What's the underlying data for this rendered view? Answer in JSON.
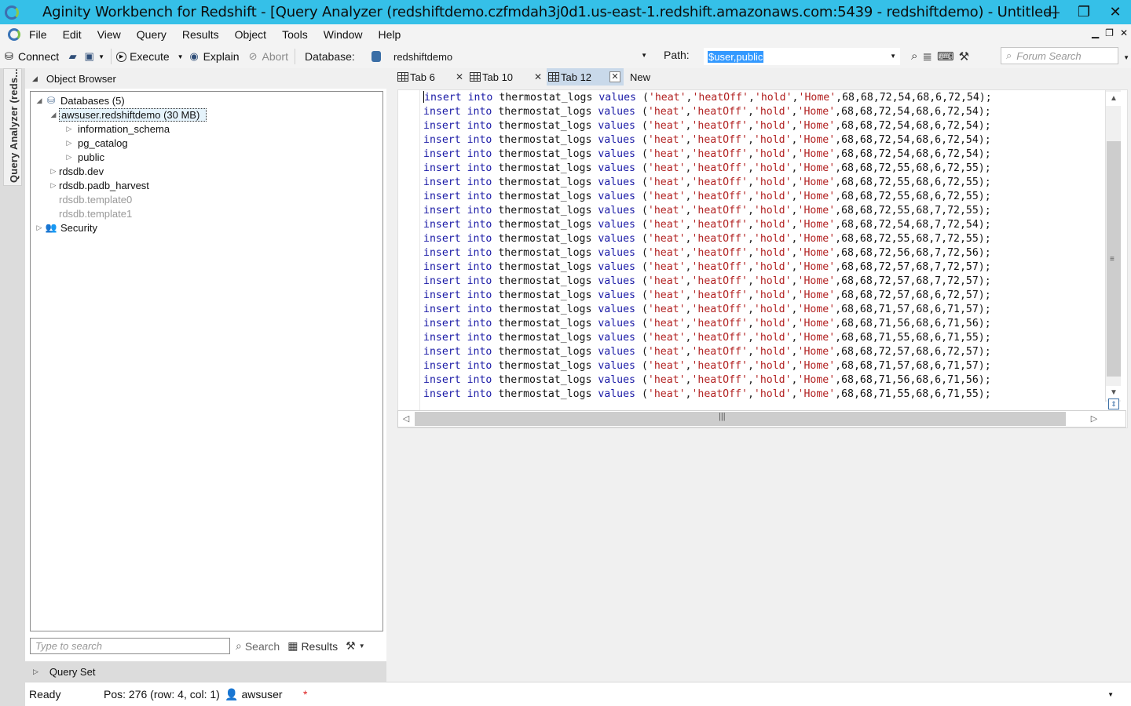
{
  "window": {
    "title": "Aginity Workbench for Redshift - [Query Analyzer (redshiftdemo.czfmdah3j0d1.us-east-1.redshift.amazonaws.com:5439 - redshiftdemo) - Untitled]",
    "minimize": "—",
    "restore": "❐",
    "close": "✕"
  },
  "menu": [
    "File",
    "Edit",
    "View",
    "Query",
    "Results",
    "Object",
    "Tools",
    "Window",
    "Help"
  ],
  "toolbar": {
    "connect": "Connect",
    "execute": "Execute",
    "explain": "Explain",
    "abort": "Abort",
    "database_label": "Database:",
    "database_value": "redshiftdemo",
    "path_label": "Path:",
    "path_value": "$user,public",
    "forum_search_placeholder": "Forum Search"
  },
  "side_tab": "Query Analyzer (reds...",
  "object_browser": {
    "title": "Object Browser",
    "tree": {
      "databases": "Databases (5)",
      "awsuser": "awsuser.redshiftdemo (30 MB)",
      "information_schema": "information_schema",
      "pg_catalog": "pg_catalog",
      "public": "public",
      "rdsdb_dev": "rdsdb.dev",
      "rdsdb_padb": "rdsdb.padb_harvest",
      "template0": "rdsdb.template0",
      "template1": "rdsdb.template1",
      "security": "Security"
    },
    "search_placeholder": "Type to search",
    "search_btn": "Search",
    "results_btn": "Results"
  },
  "query_set": "Query Set",
  "tabs": [
    {
      "label": "Tab 6"
    },
    {
      "label": "Tab 10"
    },
    {
      "label": "Tab 12"
    },
    {
      "label": "New"
    }
  ],
  "editor": {
    "keyword1": "insert",
    "keyword2": "into",
    "table": "thermostat_logs",
    "keyword3": "values",
    "lines": [
      [
        "'heat'",
        "'heatOff'",
        "'hold'",
        "'Home'",
        "68,68,72,54,68,6,72,54"
      ],
      [
        "'heat'",
        "'heatOff'",
        "'hold'",
        "'Home'",
        "68,68,72,54,68,6,72,54"
      ],
      [
        "'heat'",
        "'heatOff'",
        "'hold'",
        "'Home'",
        "68,68,72,54,68,6,72,54"
      ],
      [
        "'heat'",
        "'heatOff'",
        "'hold'",
        "'Home'",
        "68,68,72,54,68,6,72,54"
      ],
      [
        "'heat'",
        "'heatOff'",
        "'hold'",
        "'Home'",
        "68,68,72,54,68,6,72,54"
      ],
      [
        "'heat'",
        "'heatOff'",
        "'hold'",
        "'Home'",
        "68,68,72,55,68,6,72,55"
      ],
      [
        "'heat'",
        "'heatOff'",
        "'hold'",
        "'Home'",
        "68,68,72,55,68,6,72,55"
      ],
      [
        "'heat'",
        "'heatOff'",
        "'hold'",
        "'Home'",
        "68,68,72,55,68,6,72,55"
      ],
      [
        "'heat'",
        "'heatOff'",
        "'hold'",
        "'Home'",
        "68,68,72,55,68,7,72,55"
      ],
      [
        "'heat'",
        "'heatOff'",
        "'hold'",
        "'Home'",
        "68,68,72,54,68,7,72,54"
      ],
      [
        "'heat'",
        "'heatOff'",
        "'hold'",
        "'Home'",
        "68,68,72,55,68,7,72,55"
      ],
      [
        "'heat'",
        "'heatOff'",
        "'hold'",
        "'Home'",
        "68,68,72,56,68,7,72,56"
      ],
      [
        "'heat'",
        "'heatOff'",
        "'hold'",
        "'Home'",
        "68,68,72,57,68,7,72,57"
      ],
      [
        "'heat'",
        "'heatOff'",
        "'hold'",
        "'Home'",
        "68,68,72,57,68,7,72,57"
      ],
      [
        "'heat'",
        "'heatOff'",
        "'hold'",
        "'Home'",
        "68,68,72,57,68,6,72,57"
      ],
      [
        "'heat'",
        "'heatOff'",
        "'hold'",
        "'Home'",
        "68,68,71,57,68,6,71,57"
      ],
      [
        "'heat'",
        "'heatOff'",
        "'hold'",
        "'Home'",
        "68,68,71,56,68,6,71,56"
      ],
      [
        "'heat'",
        "'heatOff'",
        "'hold'",
        "'Home'",
        "68,68,71,55,68,6,71,55"
      ],
      [
        "'heat'",
        "'heatOff'",
        "'hold'",
        "'Home'",
        "68,68,72,57,68,6,72,57"
      ],
      [
        "'heat'",
        "'heatOff'",
        "'hold'",
        "'Home'",
        "68,68,71,57,68,6,71,57"
      ],
      [
        "'heat'",
        "'heatOff'",
        "'hold'",
        "'Home'",
        "68,68,71,56,68,6,71,56"
      ],
      [
        "'heat'",
        "'heatOff'",
        "'hold'",
        "'Home'",
        "68,68,71,55,68,6,71,55"
      ]
    ]
  },
  "status": {
    "ready": "Ready",
    "position": "Pos: 276 (row: 4, col: 1)",
    "user": "awsuser",
    "modified": "*"
  },
  "icons": {
    "connect": "plug-icon",
    "open": "folder-icon",
    "save": "save-icon",
    "execute": "play-icon",
    "explain": "eye-icon",
    "abort": "abort-icon",
    "database": "database-icon",
    "search": "magnifier-icon"
  }
}
